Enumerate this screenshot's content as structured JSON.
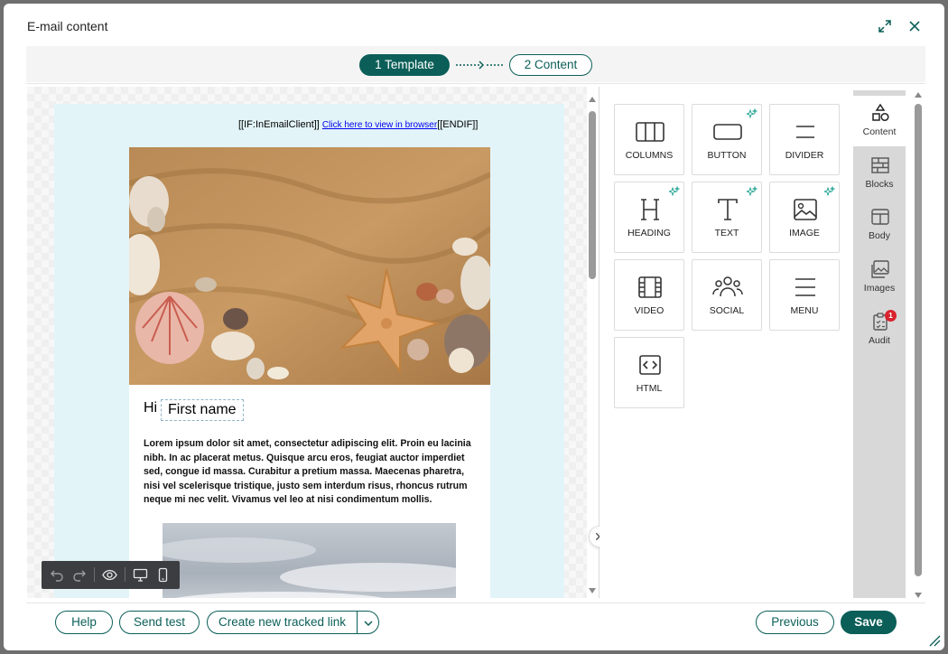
{
  "dialog": {
    "title": "E-mail content"
  },
  "steps": [
    {
      "label": "1 Template",
      "active": true
    },
    {
      "label": "2 Content",
      "active": false
    }
  ],
  "email": {
    "preheader_prefix": "[[IF:InEmailClient]]",
    "preheader_link": "Click here to view in browser",
    "preheader_suffix": "[[ENDIF]]",
    "greeting": "Hi",
    "first_name_token": "First name",
    "body_text": "Lorem ipsum dolor sit amet, consectetur adipiscing elit. Proin eu lacinia nibh. In ac placerat metus. Quisque arcu eros, feugiat auctor imperdiet sed, congue id massa. Curabitur a pretium massa. Maecenas pharetra, nisi vel scelerisque tristique, justo sem interdum risus, rhoncus rutrum neque mi nec velit. Vivamus vel leo at nisi condimentum mollis."
  },
  "content_blocks": [
    {
      "label": "COLUMNS",
      "icon": "columns-icon",
      "ai": false
    },
    {
      "label": "BUTTON",
      "icon": "button-icon",
      "ai": true
    },
    {
      "label": "DIVIDER",
      "icon": "divider-icon",
      "ai": false
    },
    {
      "label": "HEADING",
      "icon": "heading-icon",
      "ai": true
    },
    {
      "label": "TEXT",
      "icon": "text-icon",
      "ai": true
    },
    {
      "label": "IMAGE",
      "icon": "image-icon",
      "ai": true
    },
    {
      "label": "VIDEO",
      "icon": "video-icon",
      "ai": false
    },
    {
      "label": "SOCIAL",
      "icon": "social-icon",
      "ai": false
    },
    {
      "label": "MENU",
      "icon": "menu-icon",
      "ai": false
    },
    {
      "label": "HTML",
      "icon": "html-icon",
      "ai": false
    }
  ],
  "sidebar": [
    {
      "label": "Content",
      "icon": "shapes-icon",
      "active": true
    },
    {
      "label": "Blocks",
      "icon": "brick-icon",
      "active": false
    },
    {
      "label": "Body",
      "icon": "layout-icon",
      "active": false
    },
    {
      "label": "Images",
      "icon": "images-icon",
      "active": false
    },
    {
      "label": "Audit",
      "icon": "clipboard-check-icon",
      "active": false,
      "badge": "1"
    }
  ],
  "footer": {
    "help": "Help",
    "send_test": "Send test",
    "create_link": "Create new tracked link",
    "previous": "Previous",
    "save": "Save"
  },
  "colors": {
    "primary": "#0b5f58",
    "email_bg": "#e2f4f8",
    "badge": "#d9232d"
  }
}
